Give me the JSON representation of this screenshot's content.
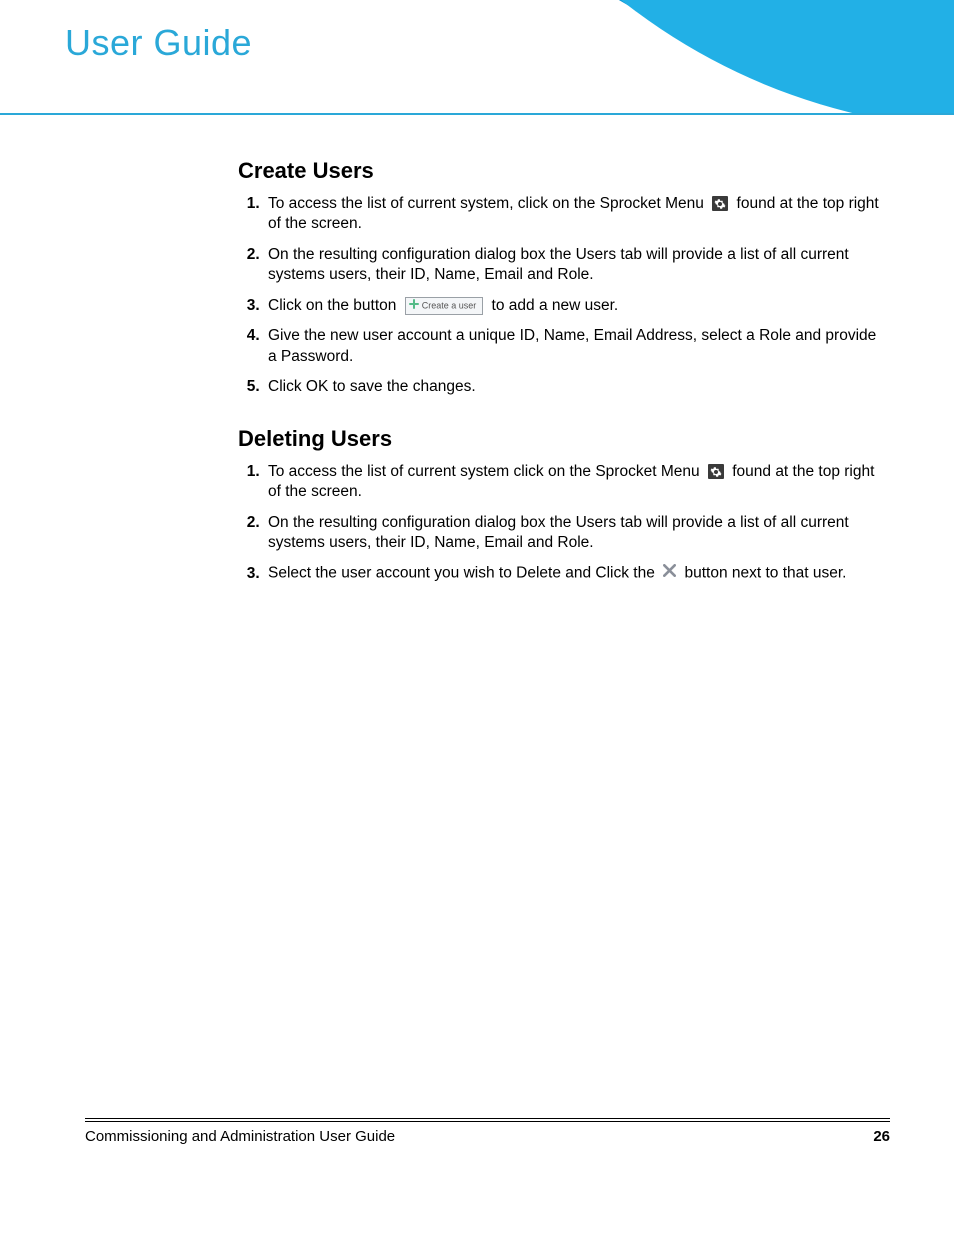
{
  "header": {
    "title": "User Guide"
  },
  "sections": {
    "create": {
      "heading": "Create Users",
      "steps": {
        "s1a": "To access the list of current system, click on the Sprocket Menu ",
        "s1b": " found at the top right of the screen.",
        "s2": "On the resulting configuration dialog box the Users tab will provide a list of all current systems users, their ID, Name, Email and Role.",
        "s3a": "Click on the button ",
        "s3b": " to add a new user.",
        "s4": "Give the new user account a unique ID, Name, Email Address, select a Role and provide a Password.",
        "s5": "Click OK to save the changes."
      }
    },
    "delete": {
      "heading": "Deleting Users",
      "steps": {
        "s1a": "To access the list of current system click on the Sprocket Menu ",
        "s1b": " found at the top right of the screen.",
        "s2": "On the resulting configuration dialog box the Users tab will provide a list of all current systems users, their ID, Name, Email and Role.",
        "s3a": "Select the user account you wish to Delete and Click the ",
        "s3b": " button next to that user."
      }
    }
  },
  "buttons": {
    "create_user_label": "Create a user"
  },
  "footer": {
    "doc_title": "Commissioning and Administration User Guide",
    "page_number": "26"
  }
}
